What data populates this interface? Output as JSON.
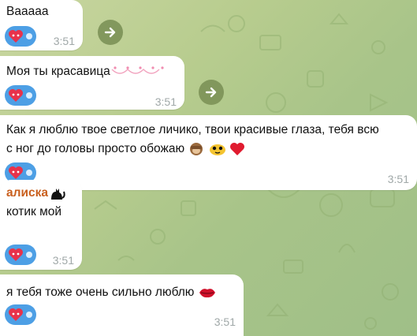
{
  "messages": [
    {
      "text": "Вааааа",
      "time": "3:51"
    },
    {
      "text": "Моя ты красавица",
      "time": "3:51"
    },
    {
      "line1": "Как я люблю твое светлое личико, твои красивые глаза, тебя всю",
      "line2": "с ног до головы просто обожаю",
      "time": "3:51"
    },
    {
      "sender": "алиска",
      "text": "котик мой",
      "time": "3:51"
    },
    {
      "text": "я тебя тоже очень сильно люблю",
      "time": "3:51"
    }
  ],
  "colors": {
    "reaction": "#4d9fe5",
    "sender": "#c9601f",
    "forward_button": "#7f955a",
    "time": "#a0a8a8"
  },
  "icons": [
    "heart-reaction-icon",
    "forward-arrow-icon",
    "monkey-emoji-icon",
    "blush-emoji-icon",
    "red-heart-emoji-icon",
    "black-cat-emoji-icon",
    "lips-emoji-icon"
  ]
}
